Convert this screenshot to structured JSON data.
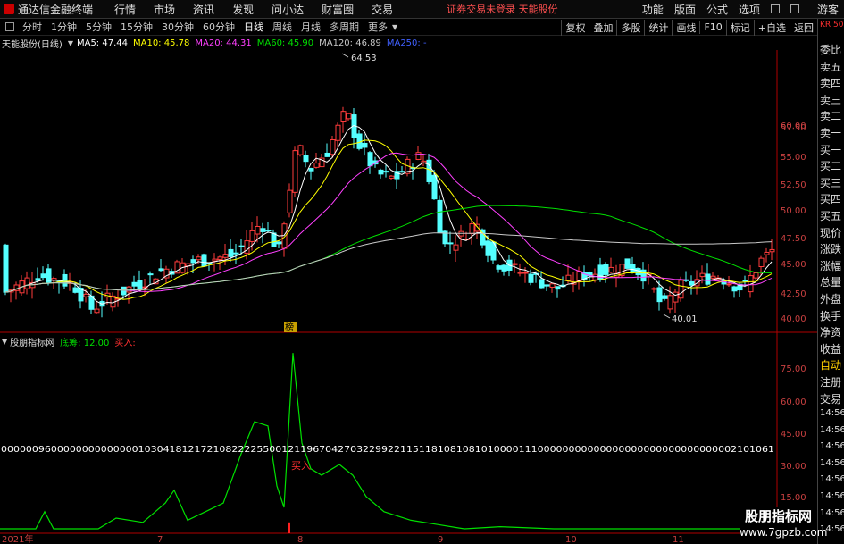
{
  "menubar": {
    "app_title": "通达信金融终端",
    "menus": [
      "行情",
      "市场",
      "资讯",
      "发现",
      "问小达",
      "财富圈",
      "交易"
    ],
    "warning": "证券交易未登录  天能股份",
    "right_menus": [
      "功能",
      "版面",
      "公式",
      "选项"
    ],
    "guest": "游客"
  },
  "periods": [
    "分时",
    "1分钟",
    "5分钟",
    "15分钟",
    "30分钟",
    "60分钟",
    "日线",
    "周线",
    "月线",
    "多周期",
    "更多"
  ],
  "active_period": "日线",
  "tools": [
    "复权",
    "叠加",
    "多股",
    "统计",
    "画线",
    "F10",
    "标记",
    "+自选",
    "返回"
  ],
  "ma_legend": {
    "stock": "天能股份(日线)",
    "ma5": "MA5: 47.44",
    "ma10": "MA10: 45.78",
    "ma20": "MA20: 44.31",
    "ma60": "MA60: 45.90",
    "ma120": "MA120: 46.89",
    "ma250": "MA250: -",
    "colors": {
      "ma5": "#ffffff",
      "ma10": "#ffff00",
      "ma20": "#ff40ff",
      "ma60": "#00e000",
      "ma120": "#c8c8c8",
      "ma250": "#4060ff"
    }
  },
  "price_annotations": {
    "high": "64.53",
    "low": "40.01",
    "badge": "榜"
  },
  "price_axis": [
    "60.00",
    "57.50",
    "55.00",
    "52.50",
    "50.00",
    "47.50",
    "45.00",
    "42.50",
    "40.00"
  ],
  "indicator": {
    "name": "股朋指标网",
    "bottom_chip": "底筹: 12.00",
    "buy_label": "买入:",
    "buy_mark": "买入",
    "axis": [
      "75.00",
      "60.00",
      "45.00",
      "30.00",
      "15.00"
    ],
    "digit_row": "0000009600000000000000103041812172108222255001211967042703229922115118108108101000011100000000000000000000000000000002101061"
  },
  "date_axis": [
    "2021年",
    "7",
    "8",
    "9",
    "10",
    "11"
  ],
  "right_panel": [
    "委比",
    "卖五",
    "卖四",
    "卖三",
    "卖二",
    "卖一",
    "买一",
    "买二",
    "买三",
    "买四",
    "买五",
    "现价",
    "涨跌",
    "涨幅",
    "总量",
    "外盘",
    "换手",
    "净资",
    "收益",
    "自动",
    "注册",
    "交易",
    "14:56",
    "14:56",
    "14:56",
    "14:56",
    "14:56",
    "14:56",
    "14:56",
    "14:56"
  ],
  "right_top": "KR 500",
  "watermark": {
    "line1": "股朋指标网",
    "line2": "www.7gpzb.com"
  }
}
